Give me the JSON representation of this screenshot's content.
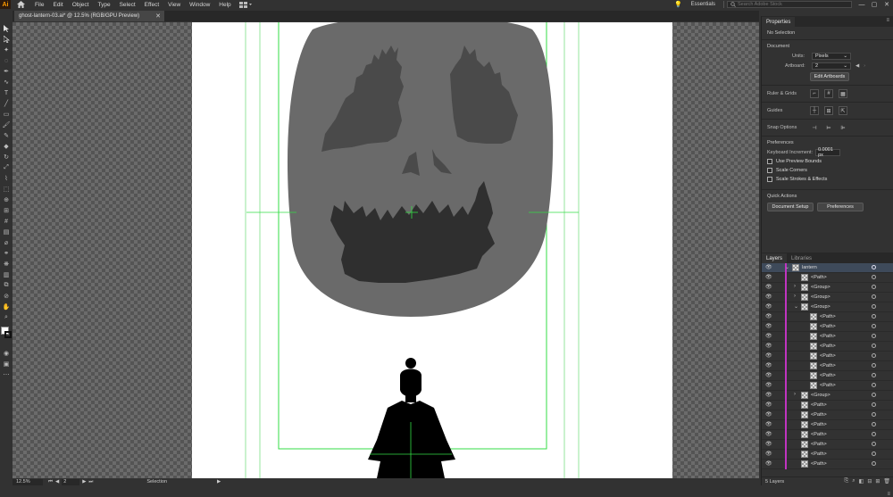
{
  "app": {
    "logo": "Ai"
  },
  "menu": [
    "File",
    "Edit",
    "Object",
    "Type",
    "Select",
    "Effect",
    "View",
    "Window",
    "Help"
  ],
  "topbar": {
    "workspace": "Essentials",
    "search_placeholder": "Search Adobe Stock",
    "minimize": "—",
    "restore": "▢",
    "close": "✕"
  },
  "document": {
    "tab_label": "ghost-lantern-03.ai* @ 12.5% (RGB/GPU Preview)",
    "tab_close": "✕"
  },
  "status": {
    "zoom": "12.5%",
    "first": "⏮",
    "prev": "◀",
    "page": "2",
    "next": "▶",
    "last": "⏭",
    "tool": "Selection",
    "play": "▶"
  },
  "properties": {
    "tab": "Properties",
    "no_selection": "No Selection",
    "document_title": "Document",
    "units_label": "Units:",
    "units_value": "Pixels",
    "artboard_label": "Artboard:",
    "artboard_value": "2",
    "edit_artboards": "Edit Artboards",
    "ruler_grids": "Ruler & Grids",
    "guides": "Guides",
    "snap_options": "Snap Options",
    "preferences_title": "Preferences",
    "keyboard_increment_label": "Keyboard Increment:",
    "keyboard_increment_value": "0.0001 px",
    "use_preview_bounds": "Use Preview Bounds",
    "scale_corners": "Scale Corners",
    "scale_strokes": "Scale Strokes & Effects",
    "quick_actions": "Quick Actions",
    "document_setup": "Document Setup",
    "preferences_btn": "Preferences"
  },
  "layers": {
    "tabs": [
      "Layers",
      "Libraries"
    ],
    "rows": [
      {
        "name": "lantern",
        "indent": 0,
        "expander": "⌄",
        "selected": true
      },
      {
        "name": "<Path>",
        "indent": 1,
        "expander": "",
        "selected": false
      },
      {
        "name": "<Group>",
        "indent": 1,
        "expander": "›",
        "selected": false
      },
      {
        "name": "<Group>",
        "indent": 1,
        "expander": "›",
        "selected": false
      },
      {
        "name": "<Group>",
        "indent": 1,
        "expander": "⌄",
        "selected": false
      },
      {
        "name": "<Path>",
        "indent": 2,
        "expander": "",
        "selected": false
      },
      {
        "name": "<Path>",
        "indent": 2,
        "expander": "",
        "selected": false
      },
      {
        "name": "<Path>",
        "indent": 2,
        "expander": "",
        "selected": false
      },
      {
        "name": "<Path>",
        "indent": 2,
        "expander": "",
        "selected": false
      },
      {
        "name": "<Path>",
        "indent": 2,
        "expander": "",
        "selected": false
      },
      {
        "name": "<Path>",
        "indent": 2,
        "expander": "",
        "selected": false
      },
      {
        "name": "<Path>",
        "indent": 2,
        "expander": "",
        "selected": false
      },
      {
        "name": "<Path>",
        "indent": 2,
        "expander": "",
        "selected": false
      },
      {
        "name": "<Group>",
        "indent": 1,
        "expander": "›",
        "selected": false
      },
      {
        "name": "<Path>",
        "indent": 1,
        "expander": "",
        "selected": false
      },
      {
        "name": "<Path>",
        "indent": 1,
        "expander": "",
        "selected": false
      },
      {
        "name": "<Path>",
        "indent": 1,
        "expander": "",
        "selected": false
      },
      {
        "name": "<Path>",
        "indent": 1,
        "expander": "",
        "selected": false
      },
      {
        "name": "<Path>",
        "indent": 1,
        "expander": "",
        "selected": false
      },
      {
        "name": "<Path>",
        "indent": 1,
        "expander": "",
        "selected": false
      },
      {
        "name": "<Path>",
        "indent": 1,
        "expander": "",
        "selected": false
      }
    ],
    "footer_count": "5 Layers"
  },
  "colors": {
    "accent_layer": "#c034c0",
    "guide": "#33dd44",
    "mask_face": "#6a6a6a",
    "mask_features": "#4a4a4a",
    "mouth": "#2f2f2f"
  }
}
